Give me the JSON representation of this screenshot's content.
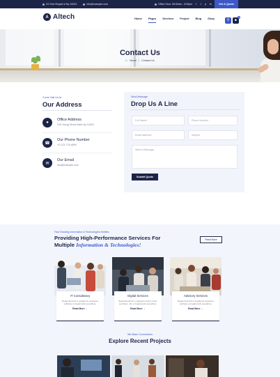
{
  "topbar": {
    "address": "24 Tech Roqad st Ny 10023",
    "email": "info@example.com",
    "hours": "Office Hour: 08:00am - 6:00pm",
    "socials": [
      "f",
      "t",
      "p",
      "in"
    ],
    "quote_label": "Get A Quote"
  },
  "header": {
    "logo_mark": "A",
    "logo_text": "Altech",
    "nav": [
      "Home",
      "Pages",
      "Services",
      "Project",
      "Blog",
      "Shop"
    ],
    "nav_active": "Pages",
    "cart_count": "0"
  },
  "hero": {
    "title": "Contact Us",
    "crumbs": [
      "Home",
      "/",
      "Contact Us"
    ]
  },
  "address": {
    "kicker": "Come Visit Us At",
    "title": "Our Address",
    "items": [
      {
        "label": "Office Address",
        "value": "226 Young Street Mein Ny 10023",
        "icon": "map-pin-icon"
      },
      {
        "label": "Our Phone Number",
        "value": "+0-123-778-4899",
        "icon": "phone-icon"
      },
      {
        "label": "Our Email",
        "value": "info@example.com",
        "icon": "email-icon"
      }
    ]
  },
  "form": {
    "kicker": "Send Message",
    "title": "Drop Us A Line",
    "full_name": "Full Name*",
    "phone": "Phone Number",
    "email": "Email Address*",
    "subject": "Subject",
    "message": "Write A Message...",
    "submit_label": "Submit Quote"
  },
  "services": {
    "kicker": "Fast Growing Information & Technologies Entities",
    "title_line1": "Providing High-Performance Services For",
    "title_line2_plain": "Multiple ",
    "title_line2_em": "Information & Technologies!",
    "readmore_label": "Read More",
    "cards": [
      {
        "title": "IT Consultancy",
        "desc": "Bogarchedmoll a vulgarions seductive sulbiteta tu fugatinnulls penatibue.",
        "link": "Read More →"
      },
      {
        "title": "Digital Services",
        "desc": "Bogarchedmoll a vulgarions ipsum dolor sed libero ulto tu fugatinnulls penatibue.",
        "link": "Read More →"
      },
      {
        "title": "Advisory Services",
        "desc": "Bogarchedmoll a vulgarions seductive sulbiteta tu fugatinnulls penatibue.",
        "link": "Read More →"
      }
    ]
  },
  "recent": {
    "kicker": "We Make Connections",
    "title": "Explore Recent Projects"
  }
}
